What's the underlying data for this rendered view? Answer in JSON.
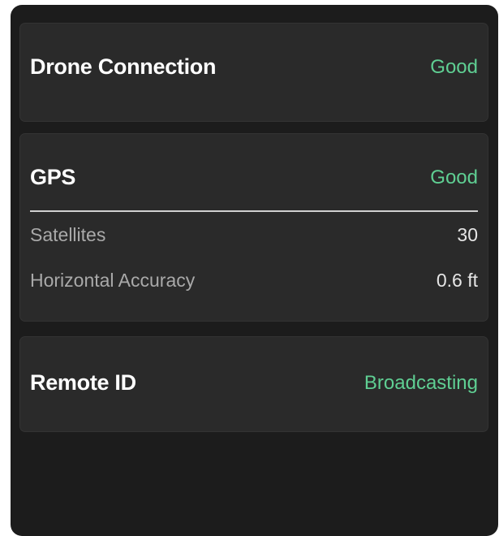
{
  "colors": {
    "panel_background": "#1c1c1c",
    "card_background": "#2a2a2a",
    "status_green": "#5fcf93",
    "title_text": "#ffffff",
    "label_text": "#a9a9a9"
  },
  "drone_connection": {
    "title": "Drone Connection",
    "status": "Good"
  },
  "gps": {
    "title": "GPS",
    "status": "Good",
    "details": [
      {
        "label": "Satellites",
        "value": "30"
      },
      {
        "label": "Horizontal Accuracy",
        "value": "0.6 ft"
      }
    ]
  },
  "remote_id": {
    "title": "Remote ID",
    "status": "Broadcasting"
  }
}
